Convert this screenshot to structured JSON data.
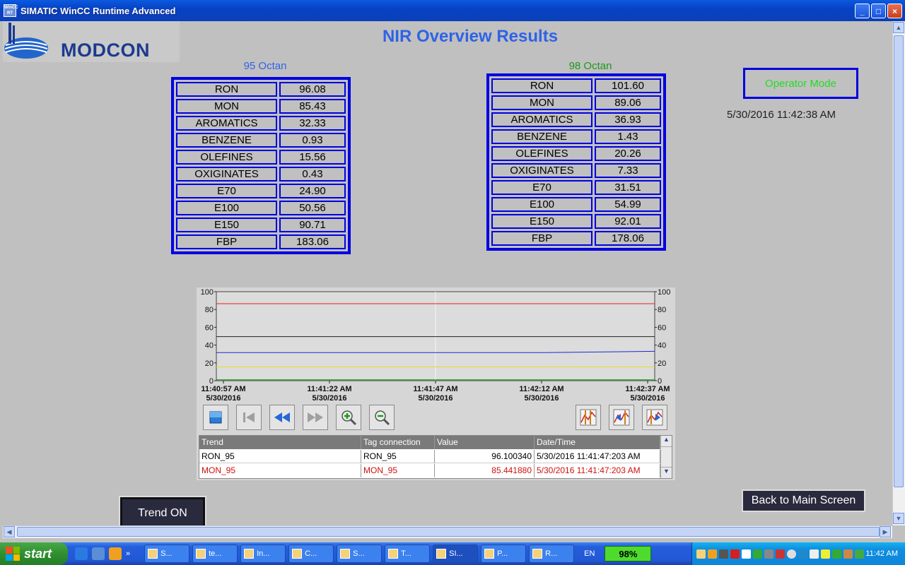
{
  "window": {
    "title": "SIMATIC WinCC Runtime Advanced",
    "icon_text": "WinCC RT"
  },
  "logo": {
    "text": "MODCON"
  },
  "page_title": "NIR Overview Results",
  "panel_95": {
    "caption": "95 Octan",
    "caption_color": "#2f63e6",
    "rows": [
      {
        "label": "RON",
        "value": "96.08"
      },
      {
        "label": "MON",
        "value": "85.43"
      },
      {
        "label": "AROMATICS",
        "value": "32.33"
      },
      {
        "label": "BENZENE",
        "value": "0.93"
      },
      {
        "label": "OLEFINES",
        "value": "15.56"
      },
      {
        "label": "OXIGINATES",
        "value": "0.43"
      },
      {
        "label": "E70",
        "value": "24.90"
      },
      {
        "label": "E100",
        "value": "50.56"
      },
      {
        "label": "E150",
        "value": "90.71"
      },
      {
        "label": "FBP",
        "value": "183.06"
      }
    ]
  },
  "panel_98": {
    "caption": "98 Octan",
    "caption_color": "#1a9a1a",
    "rows": [
      {
        "label": "RON",
        "value": "101.60"
      },
      {
        "label": "MON",
        "value": "89.06"
      },
      {
        "label": "AROMATICS",
        "value": "36.93"
      },
      {
        "label": "BENZENE",
        "value": "1.43"
      },
      {
        "label": "OLEFINES",
        "value": "20.26"
      },
      {
        "label": "OXIGINATES",
        "value": "7.33"
      },
      {
        "label": "E70",
        "value": "31.51"
      },
      {
        "label": "E100",
        "value": "54.99"
      },
      {
        "label": "E150",
        "value": "92.01"
      },
      {
        "label": "FBP",
        "value": "178.06"
      }
    ]
  },
  "operator_mode": "Operator Mode",
  "datetime": "5/30/2016 11:42:38 AM",
  "chart_data": {
    "type": "line",
    "ylim": [
      0,
      100
    ],
    "yticks": [
      "0",
      "20",
      "40",
      "60",
      "80",
      "100"
    ],
    "xticks": [
      {
        "time": "11:40:57 AM",
        "date": "5/30/2016"
      },
      {
        "time": "11:41:22 AM",
        "date": "5/30/2016"
      },
      {
        "time": "11:41:47 AM",
        "date": "5/30/2016"
      },
      {
        "time": "11:42:12 AM",
        "date": "5/30/2016"
      },
      {
        "time": "11:42:37 AM",
        "date": "5/30/2016"
      }
    ],
    "series": [
      {
        "color": "#e02020",
        "values": [
          86.5,
          86.5,
          86.5,
          86.5,
          86.5
        ]
      },
      {
        "color": "#202020",
        "values": [
          49.5,
          49.5,
          49.5,
          49.5,
          49.5
        ]
      },
      {
        "color": "#1a2ad0",
        "values": [
          31.5,
          31.5,
          31.5,
          31.5,
          33
        ]
      },
      {
        "color": "#e0e020",
        "values": [
          15.5,
          15.5,
          15.5,
          15.5,
          15.5
        ]
      },
      {
        "color": "#00a000",
        "values": [
          1,
          1,
          1,
          1,
          1
        ]
      }
    ]
  },
  "trend_table": {
    "headers": [
      "Trend",
      "Tag connection",
      "Value",
      "Date/Time"
    ],
    "rows": [
      {
        "trend": "RON_95",
        "tag": "RON_95",
        "value": "96.100340",
        "datetime": "5/30/2016 11:41:47:203 AM",
        "color": "#000000"
      },
      {
        "trend": "MON_95",
        "tag": "MON_95",
        "value": "85.441880",
        "datetime": "5/30/2016 11:41:47:203 AM",
        "color": "#d01010"
      }
    ]
  },
  "buttons": {
    "back": "Back to Main Screen",
    "trend": "Trend ON"
  },
  "taskbar": {
    "start": "start",
    "tasks": [
      "S...",
      "te...",
      "In...",
      "C...",
      "S...",
      "T...",
      "SI...",
      "P...",
      "R..."
    ],
    "lang": "EN",
    "battery": "98%",
    "clock": "11:42 AM"
  }
}
